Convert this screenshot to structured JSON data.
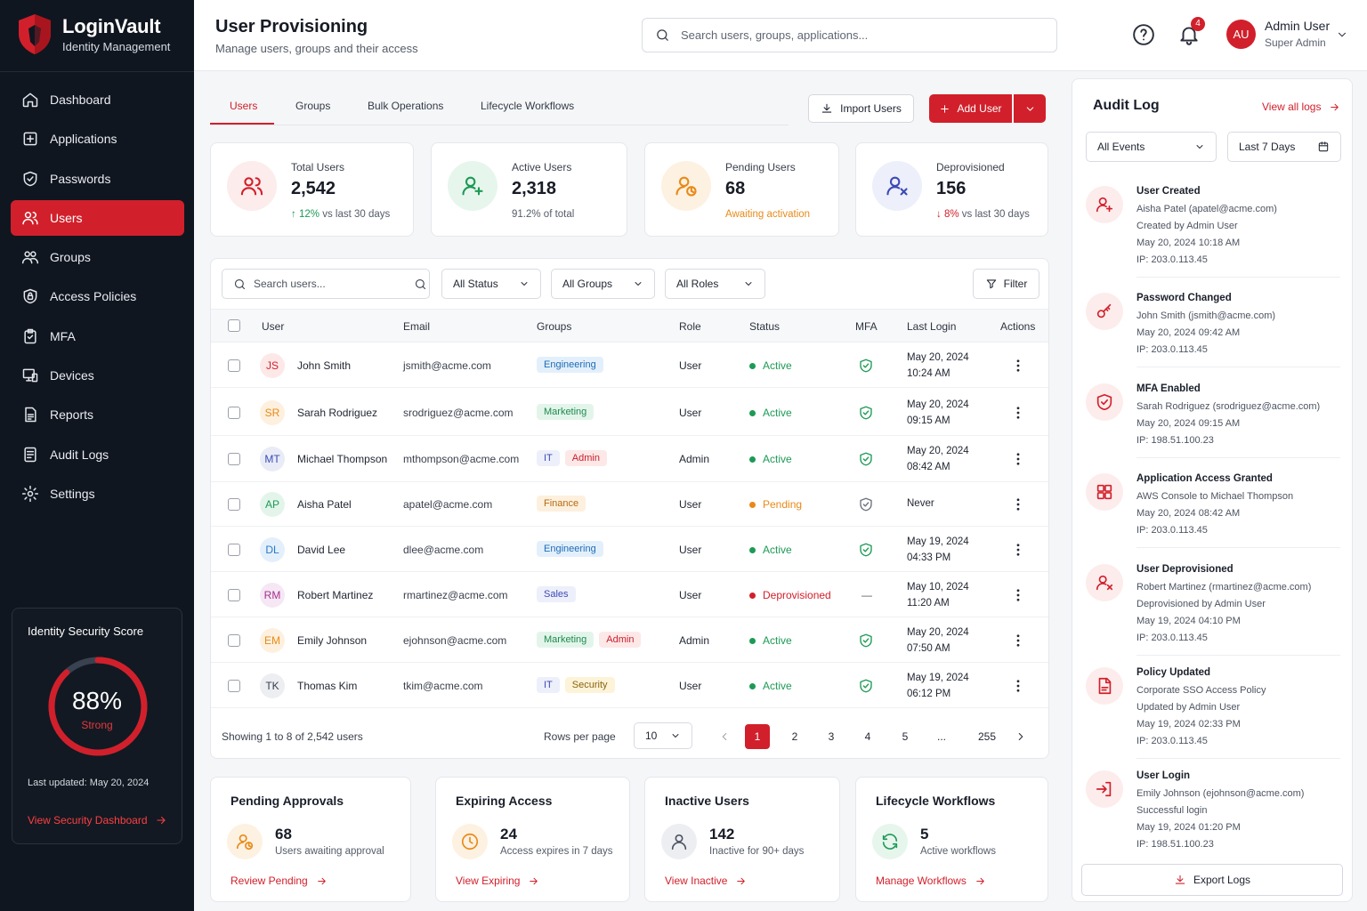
{
  "brand": {
    "name": "LoginVault",
    "tagline": "Identity Management"
  },
  "nav": [
    {
      "label": "Dashboard",
      "icon": "home-icon"
    },
    {
      "label": "Applications",
      "icon": "plus-square-icon"
    },
    {
      "label": "Passwords",
      "icon": "shield-check-icon"
    },
    {
      "label": "Users",
      "icon": "users-icon",
      "active": true
    },
    {
      "label": "Groups",
      "icon": "groups-icon"
    },
    {
      "label": "Access Policies",
      "icon": "policy-shield-icon"
    },
    {
      "label": "MFA",
      "icon": "clipboard-check-icon"
    },
    {
      "label": "Devices",
      "icon": "monitor-icon"
    },
    {
      "label": "Reports",
      "icon": "report-icon"
    },
    {
      "label": "Audit Logs",
      "icon": "log-icon"
    },
    {
      "label": "Settings",
      "icon": "gear-icon"
    }
  ],
  "security_score": {
    "title": "Identity Security Score",
    "value": "88%",
    "value_fraction": 0.88,
    "label": "Strong",
    "updated": "Last updated: May 20, 2024",
    "link": "View Security Dashboard"
  },
  "header": {
    "title": "User Provisioning",
    "subtitle": "Manage users, groups and their access",
    "search_placeholder": "Search users, groups, applications...",
    "notifications": "4",
    "user_initials": "AU",
    "user_name": "Admin User",
    "user_role": "Super Admin"
  },
  "tabs": [
    "Users",
    "Groups",
    "Bulk Operations",
    "Lifecycle Workflows"
  ],
  "actions": {
    "import": "Import Users",
    "add": "Add User"
  },
  "stats": [
    {
      "label": "Total Users",
      "value": "2,542",
      "sub_strong": "12%",
      "sub": "vs last 30 days",
      "icon": "users-icon"
    },
    {
      "label": "Active Users",
      "value": "2,318",
      "sub_strong": "",
      "sub": "91.2% of total",
      "icon": "user-plus-icon"
    },
    {
      "label": "Pending Users",
      "value": "68",
      "sub_strong": "",
      "sub": "Awaiting activation",
      "icon": "user-pending-icon"
    },
    {
      "label": "Deprovisioned",
      "value": "156",
      "sub_strong": "8%",
      "sub": "vs last 30 days",
      "icon": "user-x-icon"
    }
  ],
  "table": {
    "search_placeholder": "Search users...",
    "filters": [
      "All Status",
      "All Groups",
      "All Roles"
    ],
    "filter_button": "Filter",
    "columns": [
      "User",
      "Email",
      "Groups",
      "Role",
      "Status",
      "MFA",
      "Last Login",
      "Actions"
    ],
    "rows": [
      {
        "initials": "JS",
        "name": "John Smith",
        "email": "jsmith@acme.com",
        "groups": [
          "Engineering"
        ],
        "role": "User",
        "status": "Active",
        "mfa": "enabled",
        "login1": "May 20, 2024",
        "login2": "10:24 AM"
      },
      {
        "initials": "SR",
        "name": "Sarah Rodriguez",
        "email": "srodriguez@acme.com",
        "groups": [
          "Marketing"
        ],
        "role": "User",
        "status": "Active",
        "mfa": "enabled",
        "login1": "May 20, 2024",
        "login2": "09:15 AM"
      },
      {
        "initials": "MT",
        "name": "Michael Thompson",
        "email": "mthompson@acme.com",
        "groups": [
          "IT",
          "Admin"
        ],
        "role": "Admin",
        "status": "Active",
        "mfa": "enabled",
        "login1": "May 20, 2024",
        "login2": "08:42 AM"
      },
      {
        "initials": "AP",
        "name": "Aisha Patel",
        "email": "apatel@acme.com",
        "groups": [
          "Finance"
        ],
        "role": "User",
        "status": "Pending",
        "mfa": "disabled",
        "login1": "Never",
        "login2": ""
      },
      {
        "initials": "DL",
        "name": "David Lee",
        "email": "dlee@acme.com",
        "groups": [
          "Engineering"
        ],
        "role": "User",
        "status": "Active",
        "mfa": "enabled",
        "login1": "May 19, 2024",
        "login2": "04:33 PM"
      },
      {
        "initials": "RM",
        "name": "Robert Martinez",
        "email": "rmartinez@acme.com",
        "groups": [
          "Sales"
        ],
        "role": "User",
        "status": "Deprovisioned",
        "mfa": "none",
        "login1": "May 10, 2024",
        "login2": "11:20 AM"
      },
      {
        "initials": "EM",
        "name": "Emily Johnson",
        "email": "ejohnson@acme.com",
        "groups": [
          "Marketing",
          "Admin"
        ],
        "role": "Admin",
        "status": "Active",
        "mfa": "enabled",
        "login1": "May 20, 2024",
        "login2": "07:50 AM"
      },
      {
        "initials": "TK",
        "name": "Thomas Kim",
        "email": "tkim@acme.com",
        "groups": [
          "IT",
          "Security"
        ],
        "role": "User",
        "status": "Active",
        "mfa": "enabled",
        "login1": "May 19, 2024",
        "login2": "06:12 PM"
      }
    ],
    "footer": {
      "showing": "Showing 1 to 8 of 2,542 users",
      "rows_per_page_label": "Rows per page",
      "rows_per_page": "10",
      "pages": [
        "1",
        "2",
        "3",
        "4",
        "5",
        "...",
        "255"
      ],
      "current_page": "1"
    }
  },
  "bottom_cards": [
    {
      "title": "Pending Approvals",
      "value": "68",
      "sub": "Users awaiting approval",
      "link": "Review Pending",
      "icon": "user-pending-icon"
    },
    {
      "title": "Expiring Access",
      "value": "24",
      "sub": "Access expires in 7 days",
      "link": "View Expiring",
      "icon": "clock-icon"
    },
    {
      "title": "Inactive Users",
      "value": "142",
      "sub": "Inactive for 90+ days",
      "link": "View Inactive",
      "icon": "user-icon"
    },
    {
      "title": "Lifecycle Workflows",
      "value": "5",
      "sub": "Active workflows",
      "link": "Manage Workflows",
      "icon": "refresh-icon"
    }
  ],
  "audit": {
    "title": "Audit Log",
    "view_all": "View all logs",
    "event_filter": "All Events",
    "date_filter": "Last 7 Days",
    "export": "Export Logs",
    "events": [
      {
        "title": "User Created",
        "lines": [
          "Aisha Patel (apatel@acme.com)",
          "Created by Admin User",
          "May 20, 2024 10:18 AM",
          "IP: 203.0.113.45"
        ],
        "icon": "user-plus-icon"
      },
      {
        "title": "Password Changed",
        "lines": [
          "John Smith (jsmith@acme.com)",
          "May 20, 2024 09:42 AM",
          "IP: 203.0.113.45"
        ],
        "icon": "key-icon"
      },
      {
        "title": "MFA Enabled",
        "lines": [
          "Sarah Rodriguez (srodriguez@acme.com)",
          "May 20, 2024 09:15 AM",
          "IP: 198.51.100.23"
        ],
        "icon": "shield-check-icon"
      },
      {
        "title": "Application Access Granted",
        "lines": [
          "AWS Console to Michael Thompson",
          "May 20, 2024 08:42 AM",
          "IP: 203.0.113.45"
        ],
        "icon": "grid-icon"
      },
      {
        "title": "User Deprovisioned",
        "lines": [
          "Robert Martinez (rmartinez@acme.com)",
          "Deprovisioned by Admin User",
          "May 19, 2024 04:10 PM",
          "IP: 203.0.113.45"
        ],
        "icon": "user-x-icon"
      },
      {
        "title": "Policy Updated",
        "lines": [
          "Corporate SSO Access Policy",
          "Updated by Admin User",
          "May 19, 2024 02:33 PM",
          "IP: 203.0.113.45"
        ],
        "icon": "document-icon"
      },
      {
        "title": "User Login",
        "lines": [
          "Emily Johnson (ejohnson@acme.com)",
          "Successful login",
          "May 19, 2024 01:20 PM",
          "IP: 198.51.100.23"
        ],
        "icon": "login-icon"
      }
    ]
  },
  "colors": {
    "accent": "#d1202b",
    "sidebar": "#10161f",
    "active_green": "#1d9a56",
    "pending_orange": "#e88a18"
  }
}
